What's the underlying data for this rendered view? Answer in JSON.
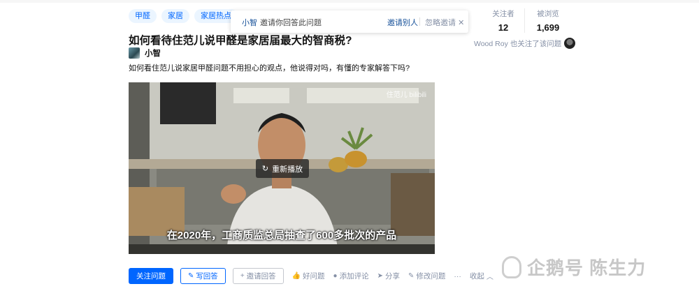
{
  "tags": [
    "甲醛",
    "家居",
    "家居热点"
  ],
  "invite_popup": {
    "user": "小智",
    "message": "邀请你回答此问题",
    "invite_others": "邀请别人",
    "ignore": "忽略邀请"
  },
  "stats": {
    "followers_label": "关注者",
    "followers_value": "12",
    "views_label": "被浏览",
    "views_value": "1,699"
  },
  "follower_note": "Wood Roy 也关注了该问题",
  "question": {
    "title": "如何看待住范儿说甲醛是家居届最大的智商税?",
    "author": "小智",
    "description": "如何看住范儿说家居甲醛问题不用担心的观点，他说得对吗，有懂的专家解答下吗?"
  },
  "video": {
    "replay_label": "重新播放",
    "subtitle": "在2020年，工商质监总局抽查了600多批次的产品",
    "watermark": "住范儿 bilibili"
  },
  "actions": {
    "follow": "关注问题",
    "write": "写回答",
    "invite": "邀请回答",
    "good": "好问题",
    "comment": "添加评论",
    "share": "分享",
    "edit": "修改问题",
    "collapse": "收起"
  },
  "brand": "企鹅号 陈生力"
}
